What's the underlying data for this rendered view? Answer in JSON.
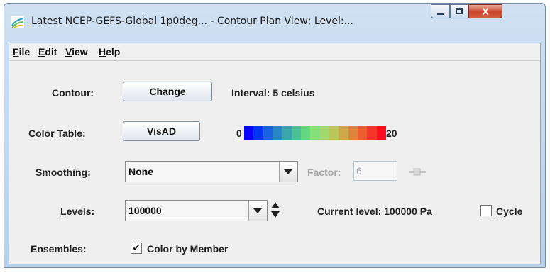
{
  "window": {
    "title": "Latest NCEP-GEFS-Global 1p0deg... - Contour Plan View; Level:..."
  },
  "menubar": {
    "items": [
      {
        "label": "File",
        "mnemonic": "F",
        "rest": "ile"
      },
      {
        "label": "Edit",
        "mnemonic": "E",
        "rest": "dit"
      },
      {
        "label": "View",
        "mnemonic": "V",
        "rest": "iew"
      },
      {
        "label": "Help",
        "mnemonic": "H",
        "rest": "elp"
      }
    ]
  },
  "contour": {
    "label": "Contour:",
    "button": "Change",
    "interval": "Interval: 5 celsius"
  },
  "color_table": {
    "label_pre": "Color ",
    "label_mn": "T",
    "label_post": "able:",
    "button": "VisAD",
    "min": "0",
    "max": "20",
    "colors": [
      "#0a00ff",
      "#0036f0",
      "#1a63e0",
      "#2a86c8",
      "#3aa5aa",
      "#4bbf96",
      "#63d680",
      "#86e07a",
      "#a2d86c",
      "#b8c65a",
      "#cca84a",
      "#dd853c",
      "#ec5d30",
      "#f6352a",
      "#ff0a22"
    ]
  },
  "smoothing": {
    "label": "Smoothing:",
    "value": "None",
    "factor_label": "Factor:",
    "factor_value": "6"
  },
  "levels": {
    "label_mn": "L",
    "label_post": "evels:",
    "value": "100000",
    "current": "Current level: 100000 Pa",
    "cycle_mn": "C",
    "cycle_post": "ycle"
  },
  "ensembles": {
    "label": "Ensembles:",
    "checkbox_label": "Color by Member",
    "checked_mark": "✔"
  },
  "window_controls": {
    "close_glyph": "X"
  }
}
